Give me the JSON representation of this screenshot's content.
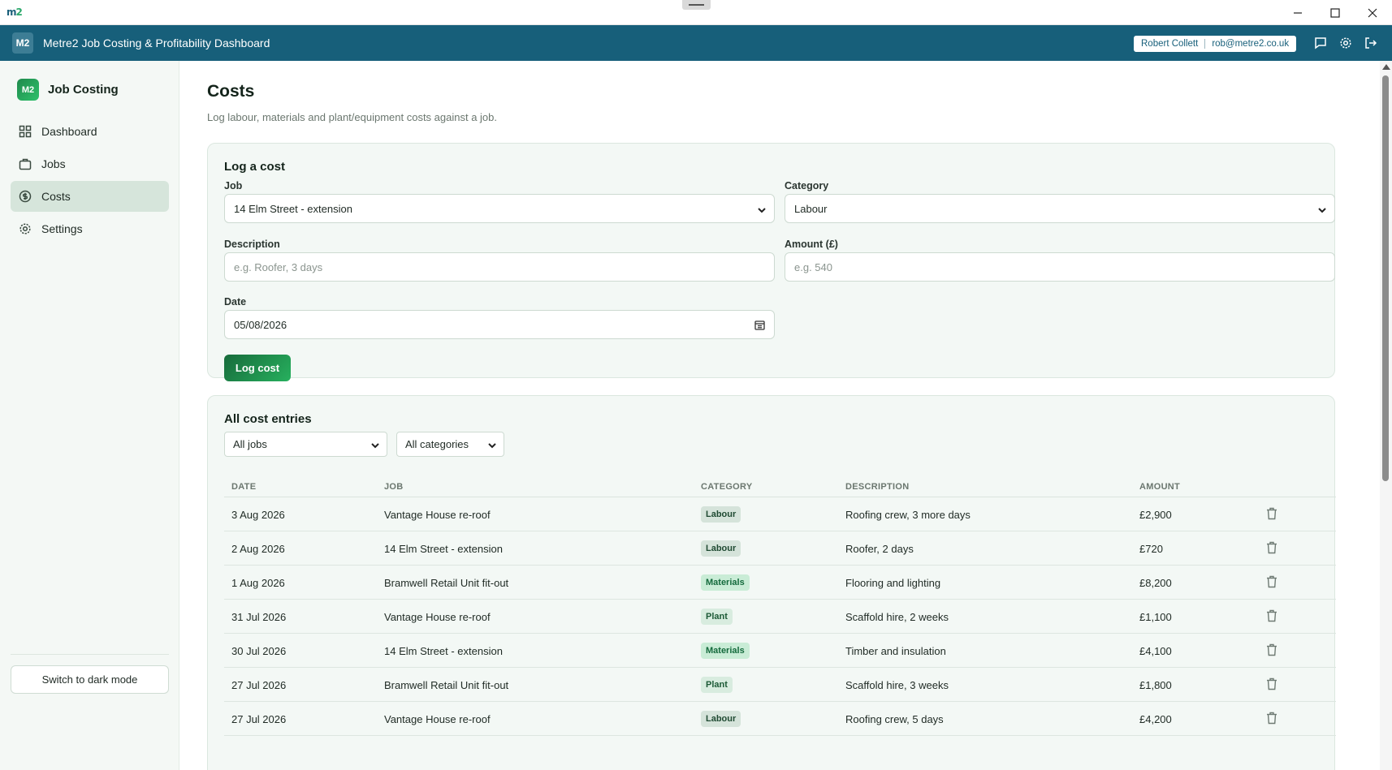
{
  "os": {
    "logo_main": "m",
    "logo_accent": "2"
  },
  "header": {
    "badge": "M2",
    "title": "Metre2 Job Costing & Profitability Dashboard",
    "user_name": "Robert Collett",
    "user_email": "rob@metre2.co.uk",
    "icons": [
      "chat-icon",
      "gear-icon",
      "logout-icon"
    ]
  },
  "sidebar": {
    "brand_badge": "M2",
    "brand_name": "Job Costing",
    "items": [
      {
        "label": "Dashboard",
        "icon": "grid-icon",
        "active": false
      },
      {
        "label": "Jobs",
        "icon": "briefcase-icon",
        "active": false
      },
      {
        "label": "Costs",
        "icon": "dollar-circle-icon",
        "active": true
      },
      {
        "label": "Settings",
        "icon": "gear-icon",
        "active": false
      }
    ],
    "dark_mode_label": "Switch to dark mode"
  },
  "page": {
    "title": "Costs",
    "subtitle": "Log labour, materials and plant/equipment costs against a job."
  },
  "form": {
    "title": "Log a cost",
    "job_label": "Job",
    "job_value": "14 Elm Street - extension",
    "category_label": "Category",
    "category_value": "Labour",
    "description_label": "Description",
    "description_placeholder": "e.g. Roofer, 3 days",
    "amount_label": "Amount (£)",
    "amount_placeholder": "e.g. 540",
    "date_label": "Date",
    "date_value": "05/08/2026",
    "submit_label": "Log cost"
  },
  "entries": {
    "title": "All cost entries",
    "job_filter": "All jobs",
    "category_filter": "All categories",
    "columns": [
      "DATE",
      "JOB",
      "CATEGORY",
      "DESCRIPTION",
      "AMOUNT"
    ],
    "rows": [
      {
        "date": "3 Aug 2026",
        "job": "Vantage House re-roof",
        "category": "Labour",
        "description": "Roofing crew, 3 more days",
        "amount": "£2,900"
      },
      {
        "date": "2 Aug 2026",
        "job": "14 Elm Street - extension",
        "category": "Labour",
        "description": "Roofer, 2 days",
        "amount": "£720"
      },
      {
        "date": "1 Aug 2026",
        "job": "Bramwell Retail Unit fit-out",
        "category": "Materials",
        "description": "Flooring and lighting",
        "amount": "£8,200"
      },
      {
        "date": "31 Jul 2026",
        "job": "Vantage House re-roof",
        "category": "Plant",
        "description": "Scaffold hire, 2 weeks",
        "amount": "£1,100"
      },
      {
        "date": "30 Jul 2026",
        "job": "14 Elm Street - extension",
        "category": "Materials",
        "description": "Timber and insulation",
        "amount": "£4,100"
      },
      {
        "date": "27 Jul 2026",
        "job": "Bramwell Retail Unit fit-out",
        "category": "Plant",
        "description": "Scaffold hire, 3 weeks",
        "amount": "£1,800"
      },
      {
        "date": "27 Jul 2026",
        "job": "Vantage House re-roof",
        "category": "Labour",
        "description": "Roofing crew, 5 days",
        "amount": "£4,200"
      }
    ]
  }
}
